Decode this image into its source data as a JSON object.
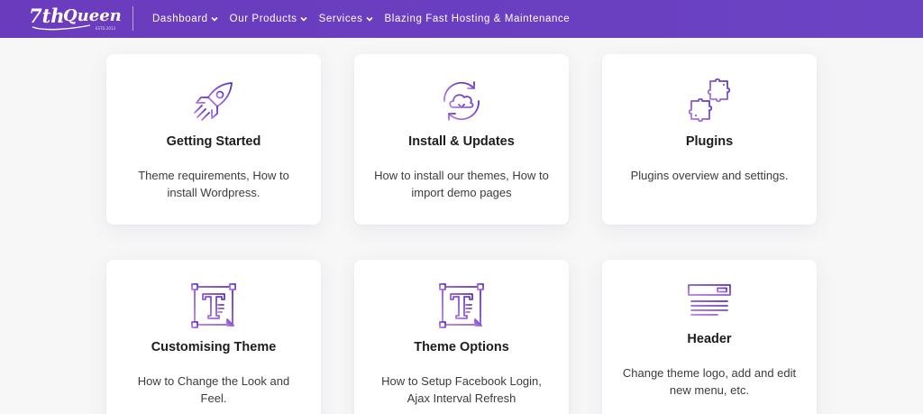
{
  "header": {
    "logo_text": "7th Queen",
    "logo_subtext": "ESTD.2013",
    "nav": [
      {
        "label": "Dashboard",
        "has_dropdown": true
      },
      {
        "label": "Our Products",
        "has_dropdown": true
      },
      {
        "label": "Services",
        "has_dropdown": true
      },
      {
        "label": "Blazing Fast Hosting & Maintenance",
        "has_dropdown": false
      }
    ],
    "background_color": "#6b3fc0"
  },
  "cards": [
    {
      "title": "Getting Started",
      "description": "Theme requirements, How to install Wordpress.",
      "icon": "rocket-icon"
    },
    {
      "title": "Install & Updates",
      "description": "How to install our themes, How to import demo pages",
      "icon": "cloud-sync-icon"
    },
    {
      "title": "Plugins",
      "description": "Plugins overview and settings.",
      "icon": "puzzle-icon"
    },
    {
      "title": "Customising Theme",
      "description": "How to Change the Look and Feel.",
      "icon": "text-edit-icon"
    },
    {
      "title": "Theme Options",
      "description": "How to Setup Facebook Login, Ajax Interval Refresh",
      "icon": "text-edit-icon"
    },
    {
      "title": "Header",
      "description": "Change theme logo, add and edit new menu, etc.",
      "icon": "header-layout-icon"
    }
  ],
  "colors": {
    "accent": "#7a3fd0",
    "accent_light": "#b07be6",
    "page_background": "#f7f7f7"
  }
}
